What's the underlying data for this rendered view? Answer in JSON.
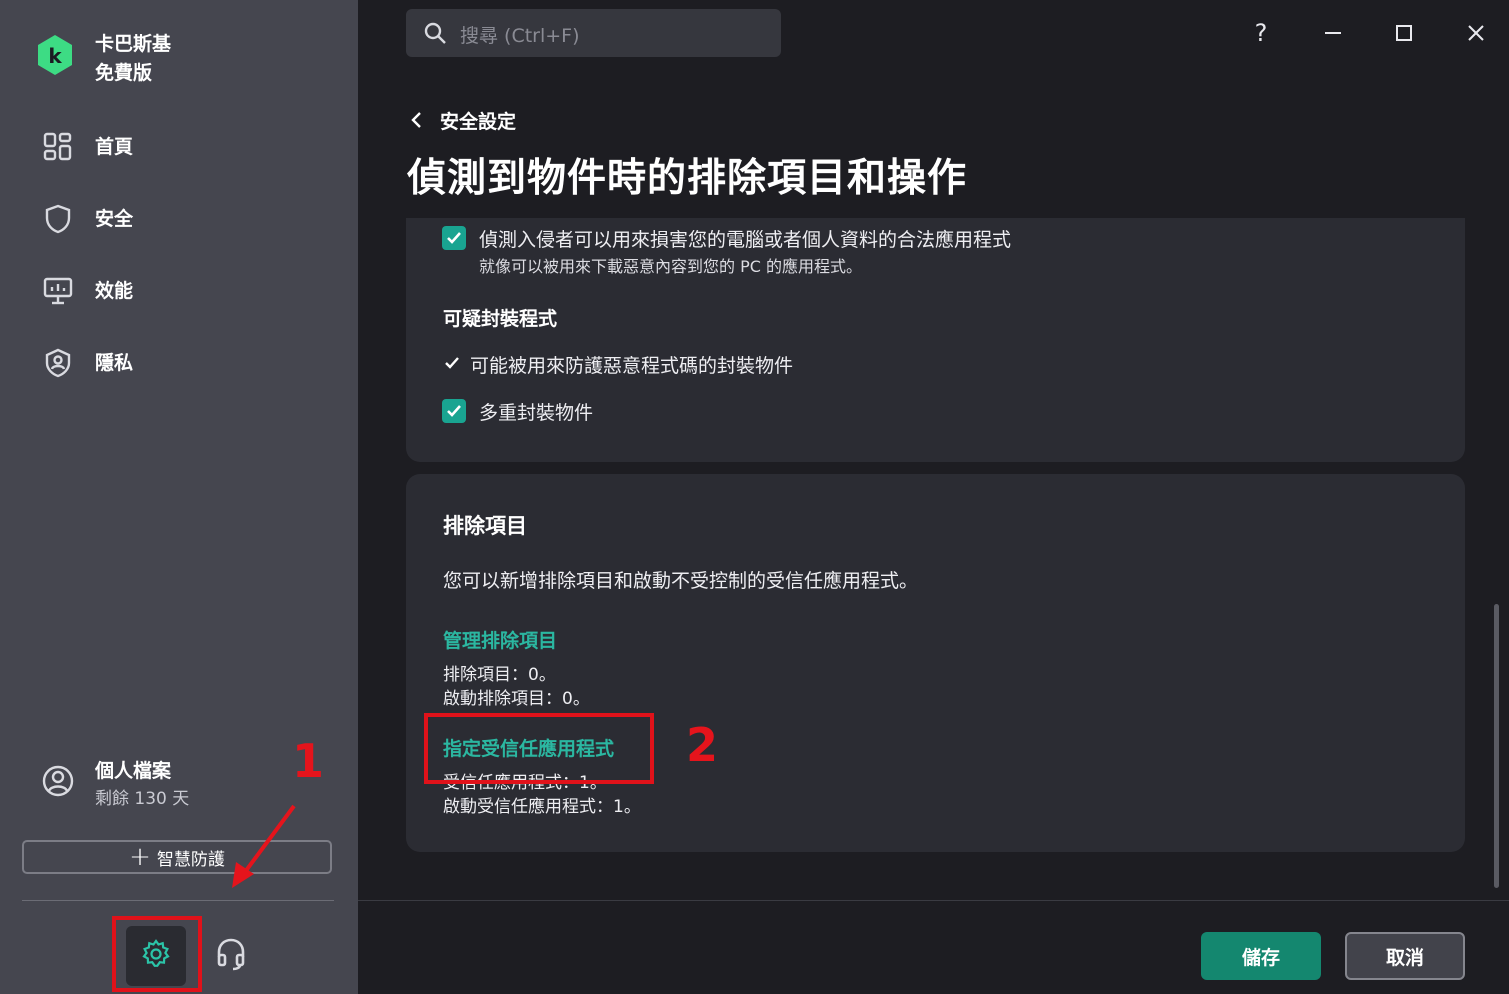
{
  "app": {
    "name_line1": "卡巴斯基",
    "name_line2": "免費版",
    "accent_color": "#19a491"
  },
  "sidebar": {
    "items": [
      {
        "label": "首頁",
        "icon": "dashboard-icon"
      },
      {
        "label": "安全",
        "icon": "shield-icon"
      },
      {
        "label": "效能",
        "icon": "performance-icon"
      },
      {
        "label": "隱私",
        "icon": "privacy-icon"
      }
    ],
    "profile": {
      "name": "個人檔案",
      "sub": "剩餘 130 天",
      "icon": "user-icon"
    },
    "smart_protect_label": "智慧防護"
  },
  "search": {
    "placeholder": "搜尋 (Ctrl+F)"
  },
  "window": {
    "help_label": "?"
  },
  "breadcrumb": {
    "back_label": "安全設定"
  },
  "page": {
    "title": "偵測到物件時的排除項目和操作"
  },
  "detect_section": {
    "legit_apps": {
      "label": "偵測入侵者可以用來損害您的電腦或者個人資料的合法應用程式",
      "sub": "就像可以被用來下載惡意內容到您的 PC 的應用程式。",
      "checked": true
    },
    "packers_heading": "可疑封裝程式",
    "packer_option": {
      "label": "可能被用來防護惡意程式碼的封裝物件",
      "checked": true
    },
    "multi_packed": {
      "label": "多重封裝物件",
      "checked": true
    }
  },
  "exclusions": {
    "heading": "排除項目",
    "description": "您可以新增排除項目和啟動不受控制的受信任應用程式。",
    "manage_link": "管理排除項目",
    "exclusions_count": "排除項目：0。",
    "active_exclusions": "啟動排除項目：0。",
    "trusted_link": "指定受信任應用程式",
    "trusted_count": "受信任應用程式：1。",
    "active_trusted": "啟動受信任應用程式：1。"
  },
  "annotations": {
    "step1": "1",
    "step2": "2",
    "highlight_color": "#e0121a"
  },
  "footer": {
    "save_label": "儲存",
    "cancel_label": "取消"
  }
}
